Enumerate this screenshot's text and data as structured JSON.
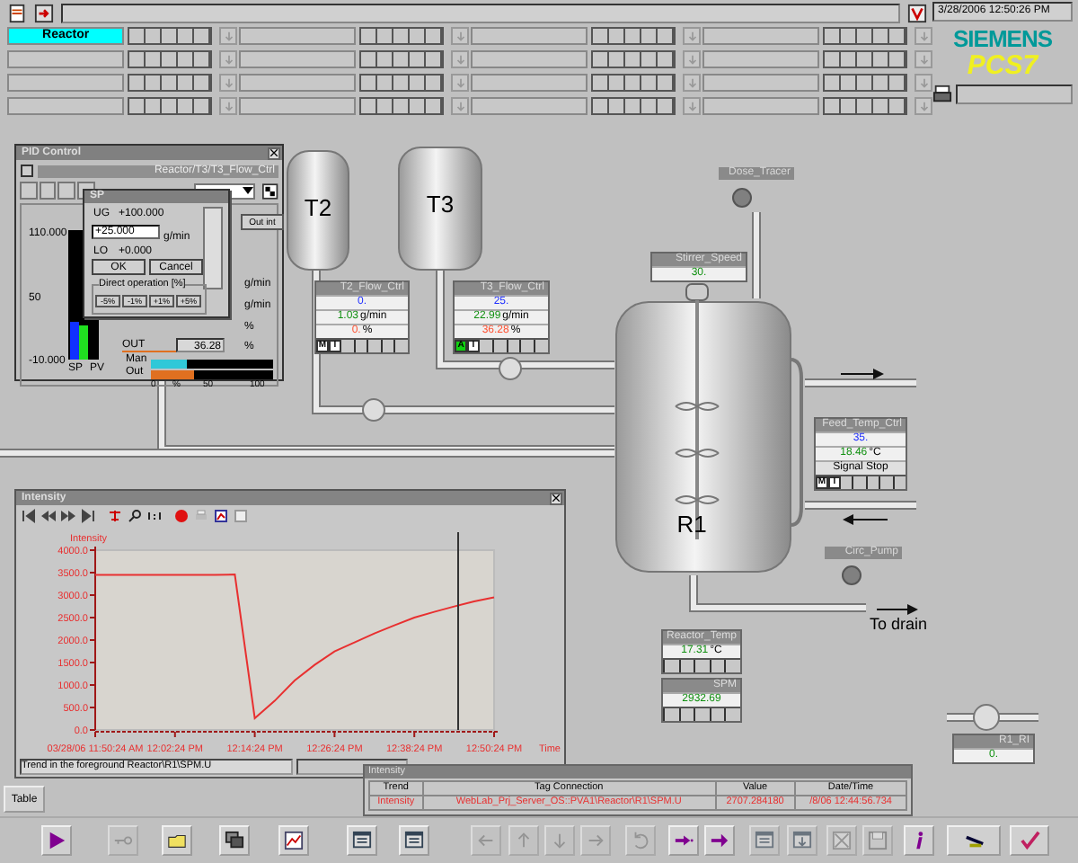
{
  "header": {
    "datetime": "3/28/2006 12:50:26 PM",
    "logo": {
      "brand": "SIEMENS",
      "product": "PCS7"
    },
    "areas": [
      {
        "label": "Reactor",
        "selected": true
      },
      {
        "selected": false
      },
      {
        "selected": false
      },
      {
        "selected": false
      },
      {
        "selected": false
      },
      {
        "selected": false
      },
      {
        "selected": false
      },
      {
        "selected": false
      },
      {
        "selected": false
      },
      {
        "selected": false
      },
      {
        "selected": false
      },
      {
        "selected": false
      },
      {
        "selected": false
      },
      {
        "selected": false
      },
      {
        "selected": false
      },
      {
        "selected": false
      }
    ]
  },
  "tanks": [
    {
      "label": "T2"
    },
    {
      "label": "T3"
    },
    {
      "label": "R1"
    }
  ],
  "faceplates": [
    {
      "kind": "controller",
      "tag": "T2_Flow_Ctrl",
      "setpoint": "0.",
      "value": "1.03",
      "unit": "g/min",
      "output": "0.",
      "output_unit": "%",
      "mode": "M",
      "auto": false,
      "interlock": "I"
    },
    {
      "kind": "controller",
      "tag": "T3_Flow_Ctrl",
      "setpoint": "25.",
      "value": "22.99",
      "unit": "g/min",
      "output": "36.28",
      "output_unit": "%",
      "mode": "A",
      "auto": true,
      "interlock": "I"
    },
    {
      "kind": "display",
      "tag": "Stirrer_Speed",
      "value": "30."
    },
    {
      "kind": "controller",
      "tag": "Feed_Temp_Ctrl",
      "setpoint": "35.",
      "value": "18.46",
      "unit": "°C",
      "status": "Signal Stop",
      "mode": "M",
      "auto": false,
      "interlock": "I"
    },
    {
      "kind": "monitor",
      "tag": "Reactor_Temp",
      "value": "17.31",
      "unit": "°C"
    },
    {
      "kind": "monitor",
      "tag": "SPM",
      "value": "2932.69"
    },
    {
      "kind": "display",
      "tag": "R1_RI",
      "value": "0."
    }
  ],
  "motors": [
    {
      "tag": "Dose_Tracer",
      "running": false
    },
    {
      "tag": "Circ_Pump",
      "running": false
    }
  ],
  "drain_label": "To drain",
  "pid_window": {
    "title": "PID Control",
    "path": "Reactor/T3/T3_Flow_Ctrl",
    "out_int_button": "Out int",
    "scale_max": "110.000",
    "scale_mid": "50",
    "scale_min": "-10.000",
    "sp_label": "SP",
    "pv_label": "PV",
    "sp_bar": {
      "level": 0.29
    },
    "pv_bar": {
      "level": 0.27
    },
    "units": [
      "g/min",
      "g/min",
      "%"
    ],
    "out_label": "OUT",
    "out_value": "36.28",
    "out_unit": "%",
    "man_label": "Man",
    "out_bar_label": "Out",
    "man_bar": {
      "level": 0.3
    },
    "out_bar": {
      "level": 0.36
    },
    "bar_ticks": [
      "0",
      "%",
      "50",
      "100"
    ],
    "sp_dialog": {
      "title": "SP",
      "ug_label": "UG",
      "ug_value": "+100.000",
      "value": "+25.000",
      "unit": "g/min",
      "lo_label": "LO",
      "lo_value": "+0.000",
      "ok_button": "OK",
      "cancel_button": "Cancel",
      "direct_label": "Direct operation [%]",
      "steps": [
        "-5%",
        "-1%",
        "+1%",
        "+5%"
      ]
    }
  },
  "trend_window": {
    "title": "Intensity",
    "status": "Trend in the foreground Reactor\\R1\\SPM.U",
    "chart_data": {
      "type": "line",
      "ylabel": "Intensity",
      "xlabel": "Time",
      "categories": [
        "03/28/06 11:50:24 AM",
        null,
        null,
        null,
        "12:02:24 PM",
        null,
        null,
        null,
        "12:14:24 PM",
        null,
        null,
        null,
        "12:26:24 PM",
        null,
        null,
        null,
        "12:38:24 PM",
        null,
        null,
        null,
        "12:50:24 PM"
      ],
      "series": [
        {
          "color": "#e83030",
          "values": [
            3450,
            3450,
            3450,
            3450,
            3450,
            3450,
            3450,
            3460,
            260,
            650,
            1100,
            1450,
            1750,
            1950,
            2150,
            2330,
            2500,
            2630,
            2750,
            2860,
            2950
          ]
        }
      ],
      "ylim": [
        0,
        4000
      ],
      "yticks": [
        {
          "value": 0,
          "label": "0.0"
        },
        {
          "value": 500,
          "label": "500.0"
        },
        {
          "value": 1000,
          "label": "1000.0"
        },
        {
          "value": 1500,
          "label": "1500.0"
        },
        {
          "value": 2000,
          "label": "2000.0"
        },
        {
          "value": 2500,
          "label": "2500.0"
        },
        {
          "value": 3000,
          "label": "3000.0"
        },
        {
          "value": 3500,
          "label": "3500.0"
        },
        {
          "value": 4000,
          "label": "4000.0"
        }
      ]
    }
  },
  "trend_legend": {
    "title": "Intensity",
    "columns": [
      "Trend",
      "Tag Connection",
      "Value",
      "Date/Time"
    ],
    "rows": [
      [
        "Intensity",
        "WebLab_Prj_Server_OS::PVA1\\Reactor\\R1\\SPM.U",
        "2707.284180",
        "/8/06 12:44:56.734"
      ]
    ]
  },
  "table_button": "Table",
  "toolbar": [
    {
      "kind": "play",
      "disabled": false
    },
    {
      "kind": "key",
      "disabled": true
    },
    {
      "kind": "folder",
      "disabled": false
    },
    {
      "kind": "stack",
      "disabled": false
    },
    {
      "kind": "chart",
      "disabled": false
    },
    {
      "kind": "window",
      "disabled": false
    },
    {
      "kind": "window",
      "disabled": false
    },
    {
      "kind": "left",
      "disabled": true
    },
    {
      "kind": "up",
      "disabled": true
    },
    {
      "kind": "down",
      "disabled": true
    },
    {
      "kind": "right",
      "disabled": true
    },
    {
      "kind": "undo",
      "disabled": true
    },
    {
      "kind": "dots-arrow",
      "disabled": false
    },
    {
      "kind": "arrow",
      "disabled": false
    },
    {
      "kind": "window-up",
      "disabled": true
    },
    {
      "kind": "window-down",
      "disabled": true
    },
    {
      "kind": "window-cross",
      "disabled": true
    },
    {
      "kind": "disk",
      "disabled": true
    },
    {
      "kind": "info",
      "disabled": false
    },
    {
      "kind": "tool",
      "disabled": false
    },
    {
      "kind": "check",
      "disabled": false
    }
  ]
}
